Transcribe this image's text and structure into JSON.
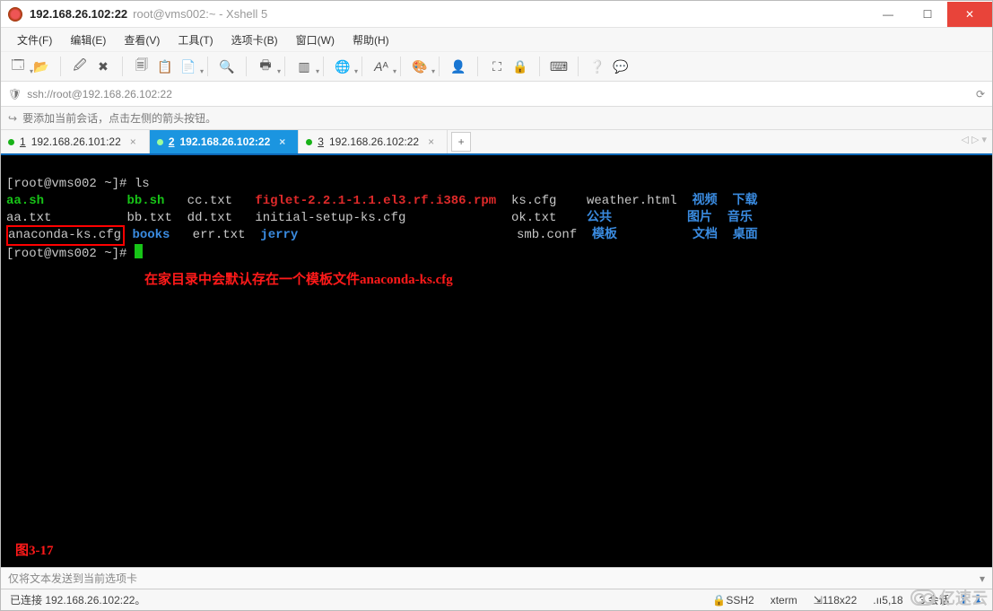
{
  "titlebar": {
    "bold": "192.168.26.102:22",
    "sub": "root@vms002:~ - Xshell 5"
  },
  "menu": {
    "file": "文件(F)",
    "edit": "编辑(E)",
    "view": "查看(V)",
    "tools": "工具(T)",
    "tabs": "选项卡(B)",
    "window": "窗口(W)",
    "help": "帮助(H)"
  },
  "address": {
    "url": "ssh://root@192.168.26.102:22"
  },
  "hint": {
    "text": "要添加当前会话，点击左侧的箭头按钮。"
  },
  "tabs": {
    "t1": "192.168.26.101:22",
    "t1n": "1",
    "t2": "192.168.26.102:22",
    "t2n": "2",
    "t3": "192.168.26.102:22",
    "t3n": "3",
    "add": "+",
    "nav": "◁  ▷ ▾"
  },
  "terminal": {
    "prompt1": "[root@vms002 ~]# ls",
    "row1": {
      "c1": "aa.sh",
      "c2": "bb.sh",
      "c3": "cc.txt",
      "c4": "figlet-2.2.1-1.1.el3.rf.i386.rpm",
      "c5": "ks.cfg",
      "c6": "weather.html",
      "c7": "视频",
      "c8": "下载"
    },
    "row2": {
      "c1": "aa.txt",
      "c2": "bb.txt",
      "c3": "dd.txt",
      "c4": "initial-setup-ks.cfg",
      "c5": "ok.txt",
      "c6": "公共",
      "c7": "图片",
      "c8": "音乐"
    },
    "row3": {
      "c1": "anaconda-ks.cfg",
      "c2": "books",
      "c3": "err.txt",
      "c4": "jerry",
      "c5": "smb.conf",
      "c6": "模板",
      "c7": "文档",
      "c8": "桌面"
    },
    "prompt2": "[root@vms002 ~]# ",
    "annotation": "在家目录中会默认存在一个模板文件anaconda-ks.cfg",
    "figlabel": "图3-17"
  },
  "sendbar": {
    "text": "仅将文本发送到当前选项卡",
    "dd": "▾"
  },
  "status": {
    "conn": "已连接 192.168.26.102:22。",
    "ssh": "SSH2",
    "term": "xterm",
    "size": "118x22",
    "pos": "5,18",
    "sess": "3 会话",
    "lock": "🔒",
    "resize": "⇲",
    "row": ".ıı",
    "updown": "⬆ ⬇"
  },
  "watermark": {
    "text": "亿速云"
  }
}
